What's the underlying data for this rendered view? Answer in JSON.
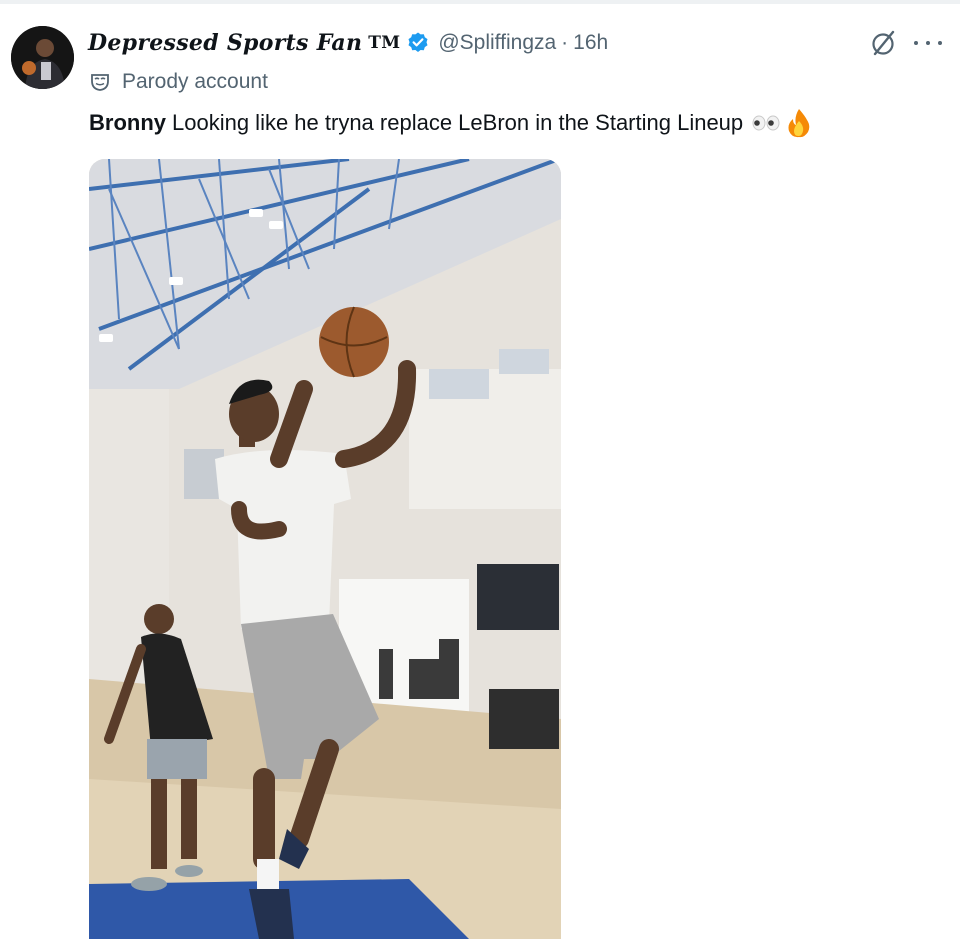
{
  "tweet": {
    "author": {
      "display_name": "Depressed Sports Fan",
      "tm": "TM",
      "handle": "@Spliffingza",
      "verified": true,
      "parody_label": "Parody account"
    },
    "time": "16h",
    "separator": "·",
    "text_bold": "Bronny",
    "text_body": "Looking like he tryna replace LeBron in the Starting Lineup",
    "emojis": [
      "eyes-emoji",
      "fire-emoji"
    ]
  },
  "colors": {
    "verified_blue": "#1d9bf0",
    "secondary_text": "#536471",
    "primary_text": "#0f1419"
  },
  "icons": {
    "grok": "grok-icon",
    "more": "more-icon",
    "parody": "parody-mask-icon"
  }
}
